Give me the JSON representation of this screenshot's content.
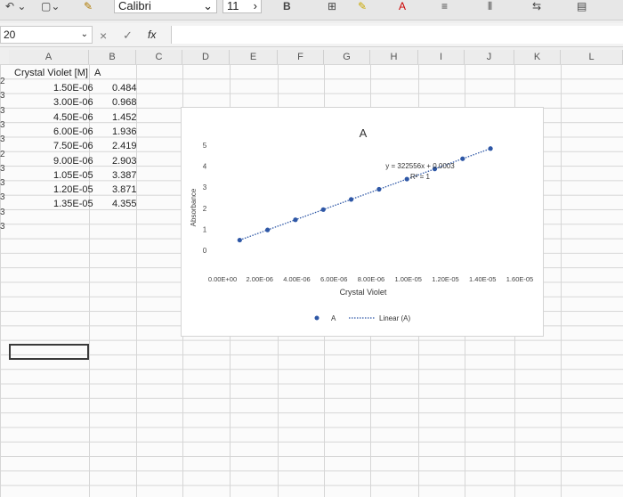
{
  "ribbon": {
    "font_name": "Calibri",
    "font_size": "11",
    "bold_label": "B"
  },
  "formula_bar": {
    "name_box": "20",
    "cancel_glyph": "×",
    "enter_glyph": "✓",
    "fx_label": "fx",
    "content": ""
  },
  "columns": [
    "A",
    "B",
    "C",
    "D",
    "E",
    "F",
    "G",
    "H",
    "I",
    "J",
    "K",
    "L"
  ],
  "row_edge_numbers": [
    "2",
    "3",
    "3",
    "3",
    "3",
    "2",
    "3",
    "3",
    "3",
    "3",
    "3"
  ],
  "table": {
    "header_a": "Crystal Violet [M]",
    "header_b": "A",
    "rows": [
      {
        "conc": "1.50E-06",
        "abs": "0.484"
      },
      {
        "conc": "3.00E-06",
        "abs": "0.968"
      },
      {
        "conc": "4.50E-06",
        "abs": "1.452"
      },
      {
        "conc": "6.00E-06",
        "abs": "1.936"
      },
      {
        "conc": "7.50E-06",
        "abs": "2.419"
      },
      {
        "conc": "9.00E-06",
        "abs": "2.903"
      },
      {
        "conc": "1.05E-05",
        "abs": "3.387"
      },
      {
        "conc": "1.20E-05",
        "abs": "3.871"
      },
      {
        "conc": "1.35E-05",
        "abs": "4.355"
      }
    ]
  },
  "chart_data": {
    "type": "scatter",
    "title": "A",
    "xlabel": "Crystal Violet",
    "ylabel": "Absorbance",
    "xlim": [
      0,
      1.6e-05
    ],
    "ylim": [
      0,
      5
    ],
    "x_tick_labels": [
      "0.00E+00",
      "2.00E-06",
      "4.00E-06",
      "6.00E-06",
      "8.00E-06",
      "1.00E-05",
      "1.20E-05",
      "1.40E-05",
      "1.60E-05"
    ],
    "y_tick_labels": [
      "0",
      "1",
      "2",
      "3",
      "4",
      "5"
    ],
    "series": [
      {
        "name": "A",
        "x": [
          1.5e-06,
          3e-06,
          4.5e-06,
          6e-06,
          7.5e-06,
          9e-06,
          1.05e-05,
          1.2e-05,
          1.35e-05,
          1.5e-05
        ],
        "y": [
          0.484,
          0.968,
          1.452,
          1.936,
          2.419,
          2.903,
          3.387,
          3.871,
          4.355,
          4.84
        ]
      }
    ],
    "trendline": {
      "name": "Linear (A)",
      "equation": "y = 322556x + 0.0003",
      "r2": "R² = 1"
    },
    "legend_position": "bottom",
    "grid": false,
    "colors": {
      "marker": "#2e57a6",
      "trend": "#2e57a6"
    }
  }
}
